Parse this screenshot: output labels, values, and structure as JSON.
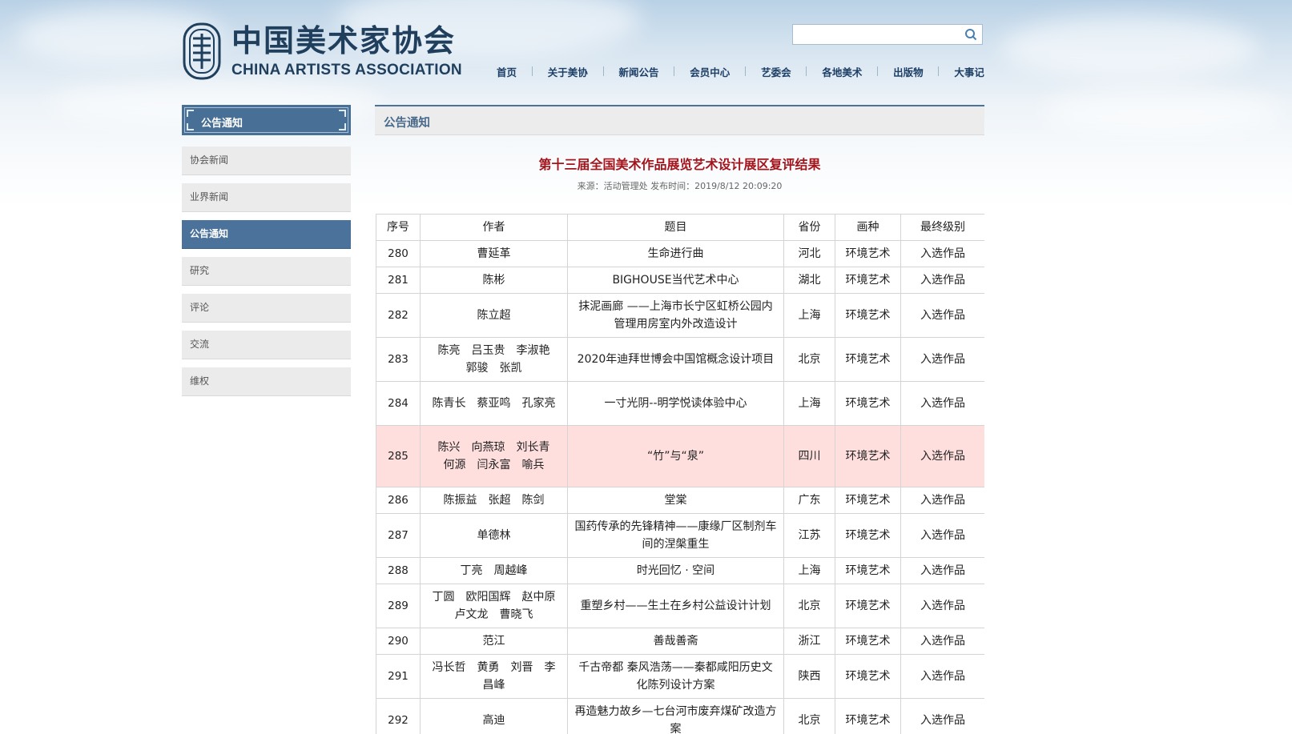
{
  "header": {
    "logo_cn": "中国美术家协会",
    "logo_en": "CHINA ARTISTS ASSOCIATION",
    "search_placeholder": ""
  },
  "nav": {
    "items": [
      "首页",
      "关于美协",
      "新闻公告",
      "会员中心",
      "艺委会",
      "各地美术",
      "出版物",
      "大事记"
    ]
  },
  "sidebar": {
    "title": "公告通知",
    "items": [
      {
        "label": "协会新闻",
        "active": false
      },
      {
        "label": "业界新闻",
        "active": false
      },
      {
        "label": "公告通知",
        "active": true
      },
      {
        "label": "研究",
        "active": false
      },
      {
        "label": "评论",
        "active": false
      },
      {
        "label": "交流",
        "active": false
      },
      {
        "label": "维权",
        "active": false
      }
    ]
  },
  "main": {
    "section_title": "公告通知",
    "article_title": "第十三届全国美术作品展览艺术设计展区复评结果",
    "meta_source": "来源：活动管理处",
    "meta_time": "发布时间：2019/8/12 20:09:20"
  },
  "table": {
    "columns": [
      "序号",
      "作者",
      "题目",
      "省份",
      "画种",
      "最终级别"
    ],
    "rows": [
      {
        "no": "280",
        "author": "曹延革",
        "title": "生命进行曲",
        "province": "河北",
        "genre": "环境艺术",
        "level": "入选作品",
        "h": 1
      },
      {
        "no": "281",
        "author": "陈彬",
        "title": "BIGHOUSE当代艺术中心",
        "province": "湖北",
        "genre": "环境艺术",
        "level": "入选作品",
        "h": 1
      },
      {
        "no": "282",
        "author": "陈立超",
        "title": "抹泥画廊 ——上海市长宁区虹桥公园内管理用房室内外改造设计",
        "province": "上海",
        "genre": "环境艺术",
        "level": "入选作品",
        "h": 2
      },
      {
        "no": "283",
        "author": "陈亮　吕玉贵　李淑艳　郭骏　张凯",
        "title": "2020年迪拜世博会中国馆概念设计项目",
        "province": "北京",
        "genre": "环境艺术",
        "level": "入选作品",
        "h": 2
      },
      {
        "no": "284",
        "author": "陈青长　蔡亚鸣　孔家亮",
        "title": "一寸光阴--明学悦读体验中心",
        "province": "上海",
        "genre": "环境艺术",
        "level": "入选作品",
        "h": 2
      },
      {
        "no": "285",
        "author": "陈兴　向燕琼　刘长青　何源　闫永富　喻兵",
        "title": "“竹”与“泉”",
        "province": "四川",
        "genre": "环境艺术",
        "level": "入选作品",
        "h": 3,
        "highlight": true
      },
      {
        "no": "286",
        "author": "陈振益　张超　陈剑",
        "title": "堂棠",
        "province": "广东",
        "genre": "环境艺术",
        "level": "入选作品",
        "h": 1
      },
      {
        "no": "287",
        "author": "单德林",
        "title": "国药传承的先锋精神——康缘厂区制剂车间的涅槃重生",
        "province": "江苏",
        "genre": "环境艺术",
        "level": "入选作品",
        "h": 2
      },
      {
        "no": "288",
        "author": "丁亮　周越峰",
        "title": "时光回忆 · 空间",
        "province": "上海",
        "genre": "环境艺术",
        "level": "入选作品",
        "h": 1
      },
      {
        "no": "289",
        "author": "丁圆　欧阳国辉　赵中原　卢文龙　曹晓飞",
        "title": "重塑乡村——生土在乡村公益设计计划",
        "province": "北京",
        "genre": "环境艺术",
        "level": "入选作品",
        "h": 2
      },
      {
        "no": "290",
        "author": "范江",
        "title": "善哉善斋",
        "province": "浙江",
        "genre": "环境艺术",
        "level": "入选作品",
        "h": 1
      },
      {
        "no": "291",
        "author": "冯长哲　黄勇　刘晋　李昌峰",
        "title": "千古帝都 秦风浩荡——秦都咸阳历史文化陈列设计方案",
        "province": "陕西",
        "genre": "环境艺术",
        "level": "入选作品",
        "h": 2
      },
      {
        "no": "292",
        "author": "高迪",
        "title": "再造魅力故乡—七台河市废弃煤矿改造方案",
        "province": "北京",
        "genre": "环境艺术",
        "level": "入选作品",
        "h": 2
      }
    ]
  },
  "colors": {
    "brand_blue": "#4a729a",
    "title_red": "#a4141c",
    "highlight_row": "#ffdede"
  }
}
